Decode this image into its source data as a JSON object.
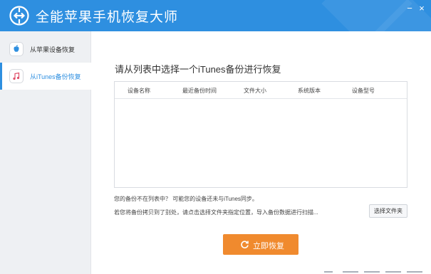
{
  "app": {
    "title": "全能苹果手机恢复大师"
  },
  "window_controls": {
    "minimize": "−",
    "close": "×"
  },
  "sidebar": {
    "items": [
      {
        "label": "从苹果设备恢复",
        "icon": "apple-icon",
        "active": false
      },
      {
        "label": "从iTunes备份恢复",
        "icon": "itunes-music-icon",
        "active": true
      }
    ]
  },
  "main": {
    "title": "请从列表中选择一个iTunes备份进行恢复",
    "table": {
      "columns": [
        "设备名称",
        "最近备份时间",
        "文件大小",
        "系统版本",
        "设备型号"
      ],
      "rows": []
    },
    "hint_line1": "您的备份不在列表中？ 可能您的设备还未与iTunes同步。",
    "hint_line2": "若您将备份拷贝到了别处，请点击选择文件夹指定位置，导入备份数据进行扫描...",
    "select_folder_label": "选择文件夹",
    "recover_label": "立即恢复"
  },
  "colors": {
    "accent": "#2e8fe0",
    "button": "#f08a2e",
    "sidebar_bg": "#eef0f3"
  }
}
